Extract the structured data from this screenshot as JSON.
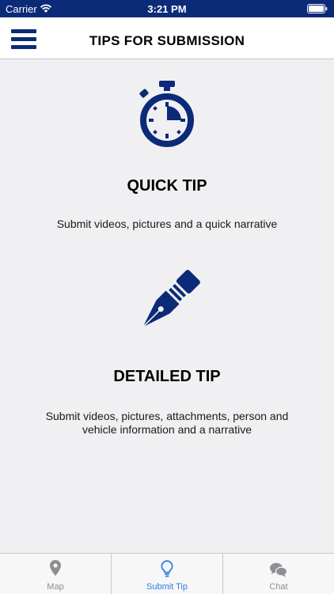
{
  "status": {
    "carrier": "Carrier",
    "time": "3:21 PM"
  },
  "header": {
    "title": "TIPS FOR SUBMISSION"
  },
  "tips": [
    {
      "title": "QUICK TIP",
      "description": "Submit videos, pictures and a quick narrative",
      "icon": "stopwatch-icon"
    },
    {
      "title": "DETAILED TIP",
      "description": "Submit videos, pictures, attachments, person and vehicle information and a narrative",
      "icon": "pen-nib-icon"
    }
  ],
  "tabs": [
    {
      "label": "Map",
      "icon": "map-pin-icon",
      "active": false
    },
    {
      "label": "Submit Tip",
      "icon": "lightbulb-icon",
      "active": true
    },
    {
      "label": "Chat",
      "icon": "chat-bubbles-icon",
      "active": false
    }
  ],
  "colors": {
    "brand": "#0b2a78",
    "accent": "#2a7de1",
    "background": "#f0f0f2"
  }
}
